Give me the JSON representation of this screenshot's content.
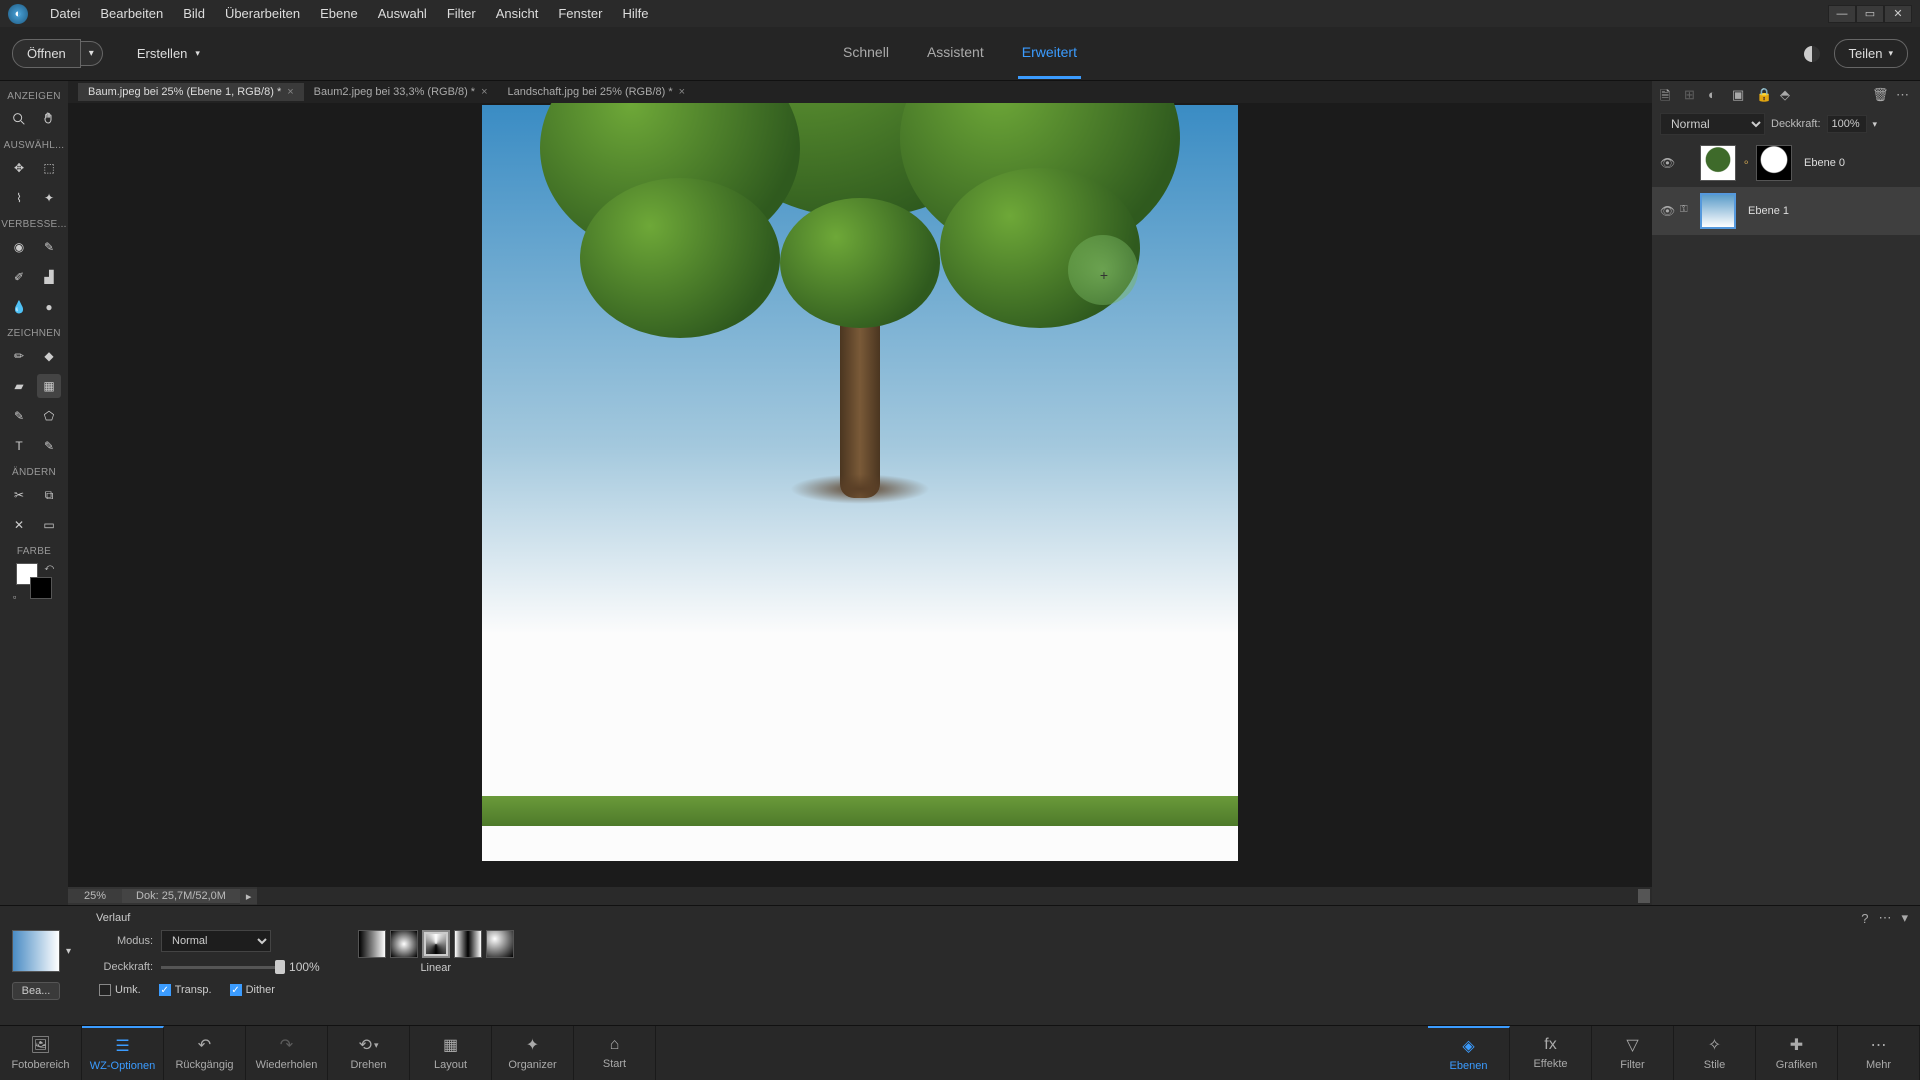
{
  "menubar": [
    "Datei",
    "Bearbeiten",
    "Bild",
    "Überarbeiten",
    "Ebene",
    "Auswahl",
    "Filter",
    "Ansicht",
    "Fenster",
    "Hilfe"
  ],
  "actionbar": {
    "open": "Öffnen",
    "create": "Erstellen",
    "share": "Teilen"
  },
  "modeTabs": {
    "quick": "Schnell",
    "guided": "Assistent",
    "expert": "Erweitert"
  },
  "docTabs": [
    {
      "label": "Baum.jpeg bei 25% (Ebene 1, RGB/8) *",
      "active": true
    },
    {
      "label": "Baum2.jpeg bei 33,3% (RGB/8) *",
      "active": false
    },
    {
      "label": "Landschaft.jpg bei 25% (RGB/8) *",
      "active": false
    }
  ],
  "statusbar": {
    "zoom": "25%",
    "doc": "Dok: 25,7M/52,0M"
  },
  "toolbox": {
    "sections": {
      "show": "ANZEIGEN",
      "select": "AUSWÄHL...",
      "enhance": "VERBESSE...",
      "draw": "ZEICHNEN",
      "modify": "ÄNDERN",
      "color": "FARBE"
    }
  },
  "layersPanel": {
    "blend": "Normal",
    "opacityLabel": "Deckkraft:",
    "opacityVal": "100%",
    "layers": [
      {
        "name": "Ebene 0"
      },
      {
        "name": "Ebene 1"
      }
    ]
  },
  "toolOpts": {
    "title": "Verlauf",
    "edit": "Bea...",
    "modeLabel": "Modus:",
    "modeVal": "Normal",
    "opacityLabel": "Deckkraft:",
    "opacityVal": "100%",
    "reverse": "Umk.",
    "transp": "Transp.",
    "dither": "Dither",
    "typeLabel": "Linear"
  },
  "taskbar": {
    "left": [
      {
        "label": "Fotobereich"
      },
      {
        "label": "WZ-Optionen"
      },
      {
        "label": "Rückgängig"
      },
      {
        "label": "Wiederholen"
      },
      {
        "label": "Drehen"
      },
      {
        "label": "Layout"
      },
      {
        "label": "Organizer"
      },
      {
        "label": "Start"
      }
    ],
    "right": [
      {
        "label": "Ebenen"
      },
      {
        "label": "Effekte"
      },
      {
        "label": "Filter"
      },
      {
        "label": "Stile"
      },
      {
        "label": "Grafiken"
      },
      {
        "label": "Mehr"
      }
    ]
  }
}
